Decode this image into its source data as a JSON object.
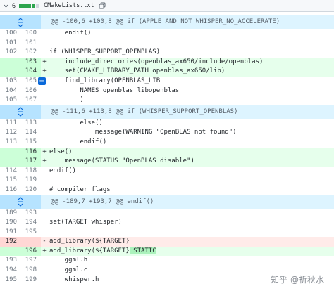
{
  "header": {
    "expand_icon": "chevron-down",
    "change_count": "6",
    "filename": "CMakeLists.txt",
    "copy_icon": "copy"
  },
  "rows": [
    {
      "type": "hunk",
      "code": "@@ -100,6 +100,8 @@ if (APPLE AND NOT WHISPER_NO_ACCELERATE)"
    },
    {
      "type": "ctx",
      "old": "100",
      "new": "100",
      "code": "    endif()"
    },
    {
      "type": "ctx",
      "old": "101",
      "new": "101",
      "code": ""
    },
    {
      "type": "ctx",
      "old": "102",
      "new": "102",
      "code": "if (WHISPER_SUPPORT_OPENBLAS)"
    },
    {
      "type": "add",
      "old": "",
      "new": "103",
      "sign": "+",
      "code": "    include_directories(openblas_ax650/include/openblas)"
    },
    {
      "type": "add",
      "old": "",
      "new": "104",
      "sign": "+",
      "code": "    set(CMAKE_LIBRARY_PATH openblas_ax650/lib)"
    },
    {
      "type": "ctx",
      "old": "103",
      "new": "105",
      "code": "    find_library(OPENBLAS_LIB"
    },
    {
      "type": "ctx",
      "old": "104",
      "new": "106",
      "code": "        NAMES openblas libopenblas"
    },
    {
      "type": "ctx",
      "old": "105",
      "new": "107",
      "code": "        )"
    },
    {
      "type": "hunk",
      "code": "@@ -111,6 +113,8 @@ if (WHISPER_SUPPORT_OPENBLAS)"
    },
    {
      "type": "ctx",
      "old": "111",
      "new": "113",
      "code": "        else()"
    },
    {
      "type": "ctx",
      "old": "112",
      "new": "114",
      "code": "            message(WARNING \"OpenBLAS not found\")"
    },
    {
      "type": "ctx",
      "old": "113",
      "new": "115",
      "code": "        endif()"
    },
    {
      "type": "add",
      "old": "",
      "new": "116",
      "sign": "+",
      "code": "else()"
    },
    {
      "type": "add",
      "old": "",
      "new": "117",
      "sign": "+",
      "code": "    message(STATUS \"OpenBLAS disable\")"
    },
    {
      "type": "ctx",
      "old": "114",
      "new": "118",
      "code": "endif()"
    },
    {
      "type": "ctx",
      "old": "115",
      "new": "119",
      "code": ""
    },
    {
      "type": "ctx",
      "old": "116",
      "new": "120",
      "code": "# compiler flags"
    },
    {
      "type": "hunk",
      "code": "@@ -189,7 +193,7 @@ endif()"
    },
    {
      "type": "ctx",
      "old": "189",
      "new": "193",
      "code": ""
    },
    {
      "type": "ctx",
      "old": "190",
      "new": "194",
      "code": "set(TARGET whisper)"
    },
    {
      "type": "ctx",
      "old": "191",
      "new": "195",
      "code": ""
    },
    {
      "type": "del",
      "old": "192",
      "new": "",
      "sign": "-",
      "code": "add_library(${TARGET}"
    },
    {
      "type": "add",
      "old": "",
      "new": "196",
      "sign": "+",
      "code": "add_library(${TARGET}",
      "highlight": " STATIC"
    },
    {
      "type": "ctx",
      "old": "193",
      "new": "197",
      "code": "    ggml.h"
    },
    {
      "type": "ctx",
      "old": "194",
      "new": "198",
      "code": "    ggml.c"
    },
    {
      "type": "ctx",
      "old": "195",
      "new": "199",
      "code": "    whisper.h"
    }
  ],
  "watermark": "知乎 @祈秋水"
}
